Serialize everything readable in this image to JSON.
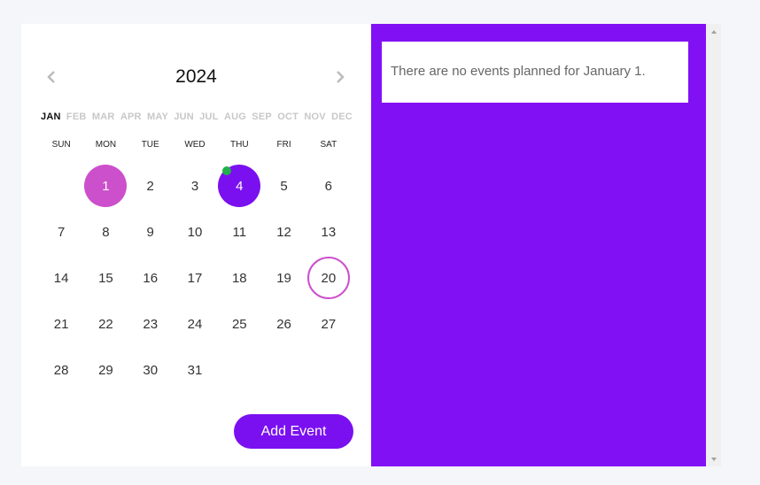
{
  "calendar": {
    "year": "2024",
    "months": [
      "JAN",
      "FEB",
      "MAR",
      "APR",
      "MAY",
      "JUN",
      "JUL",
      "AUG",
      "SEP",
      "OCT",
      "NOV",
      "DEC"
    ],
    "active_month": "JAN",
    "weekdays": [
      "SUN",
      "MON",
      "TUE",
      "WED",
      "THU",
      "FRI",
      "SAT"
    ],
    "first_weekday_offset": 1,
    "days": [
      "1",
      "2",
      "3",
      "4",
      "5",
      "6",
      "7",
      "8",
      "9",
      "10",
      "11",
      "12",
      "13",
      "14",
      "15",
      "16",
      "17",
      "18",
      "19",
      "20",
      "21",
      "22",
      "23",
      "24",
      "25",
      "26",
      "27",
      "28",
      "29",
      "30",
      "31"
    ],
    "selected_day": "1",
    "event_day": "4",
    "today_day": "20",
    "prev_icon": "chevron-left-icon",
    "next_icon": "chevron-right-icon"
  },
  "add_event_label": "Add Event",
  "events_panel": {
    "message": "There are no events planned for January 1."
  },
  "colors": {
    "accent": "#7a10f0",
    "panel": "#8210f4",
    "selected": "#cc4fcc",
    "event_dot": "#22b14c"
  }
}
